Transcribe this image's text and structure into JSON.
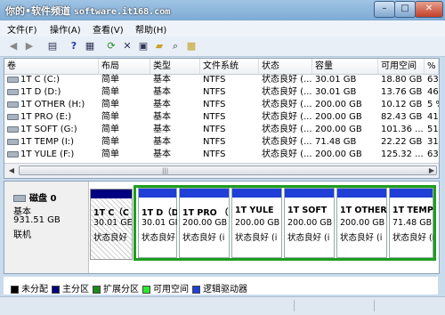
{
  "window": {
    "title": "你的•软件频道",
    "site": "software.it168.com"
  },
  "menu": [
    "文件(F)",
    "操作(A)",
    "查看(V)",
    "帮助(H)"
  ],
  "toolbar_icons": [
    "back-icon",
    "forward-icon",
    "console-tree-icon",
    "help-icon",
    "properties-icon",
    "refresh-icon",
    "delete-icon",
    "settings-icon",
    "open-icon",
    "search-icon",
    "export-icon"
  ],
  "columns": [
    "卷",
    "布局",
    "类型",
    "文件系统",
    "状态",
    "容量",
    "可用空间",
    "%"
  ],
  "volumes": [
    {
      "name": "1T C (C:)",
      "layout": "简单",
      "type": "基本",
      "fs": "NTFS",
      "status": "状态良好 (...",
      "capacity": "30.01 GB",
      "free": "18.80 GB",
      "pct": "63"
    },
    {
      "name": "1T D (D:)",
      "layout": "简单",
      "type": "基本",
      "fs": "NTFS",
      "status": "状态良好 (...",
      "capacity": "30.01 GB",
      "free": "13.76 GB",
      "pct": "46"
    },
    {
      "name": "1T OTHER (H:)",
      "layout": "简单",
      "type": "基本",
      "fs": "NTFS",
      "status": "状态良好 (...",
      "capacity": "200.00 GB",
      "free": "10.12 GB",
      "pct": "5 %"
    },
    {
      "name": "1T PRO (E:)",
      "layout": "简单",
      "type": "基本",
      "fs": "NTFS",
      "status": "状态良好 (...",
      "capacity": "200.00 GB",
      "free": "82.43 GB",
      "pct": "41"
    },
    {
      "name": "1T SOFT (G:)",
      "layout": "简单",
      "type": "基本",
      "fs": "NTFS",
      "status": "状态良好 (...",
      "capacity": "200.00 GB",
      "free": "101.36 ...",
      "pct": "51"
    },
    {
      "name": "1T TEMP (I:)",
      "layout": "简单",
      "type": "基本",
      "fs": "NTFS",
      "status": "状态良好 (...",
      "capacity": "71.48 GB",
      "free": "22.22 GB",
      "pct": "31"
    },
    {
      "name": "1T YULE (F:)",
      "layout": "简单",
      "type": "基本",
      "fs": "NTFS",
      "status": "状态良好 (...",
      "capacity": "200.00 GB",
      "free": "125.32 ...",
      "pct": "63"
    }
  ],
  "disk": {
    "name": "磁盘 0",
    "kind": "基本",
    "size": "931.51 GB",
    "state": "联机"
  },
  "partitions": [
    {
      "name": "1T C（C",
      "size": "30.01 GE",
      "status": "状态良好"
    },
    {
      "name": "1T D（D",
      "size": "30.01 GI",
      "status": "状态良好"
    },
    {
      "name": "1T PRO （",
      "size": "200.00 GB",
      "status": "状态良好 (i"
    },
    {
      "name": "1T YULE",
      "size": "200.00 GB",
      "status": "状态良好 (i"
    },
    {
      "name": "1T SOFT",
      "size": "200.00 GB",
      "status": "状态良好 (i"
    },
    {
      "name": "1T OTHER",
      "size": "200.00 GB",
      "status": "状态良好 (i"
    },
    {
      "name": "1T TEMP",
      "size": "71.48 GB",
      "status": "状态良好 (i"
    }
  ],
  "legend": [
    {
      "label": "未分配",
      "color": "#000000"
    },
    {
      "label": "主分区",
      "color": "#000080"
    },
    {
      "label": "扩展分区",
      "color": "#1d8a1d"
    },
    {
      "label": "可用空间",
      "color": "#2ee82e"
    },
    {
      "label": "逻辑驱动器",
      "color": "#1f3fd6"
    }
  ]
}
